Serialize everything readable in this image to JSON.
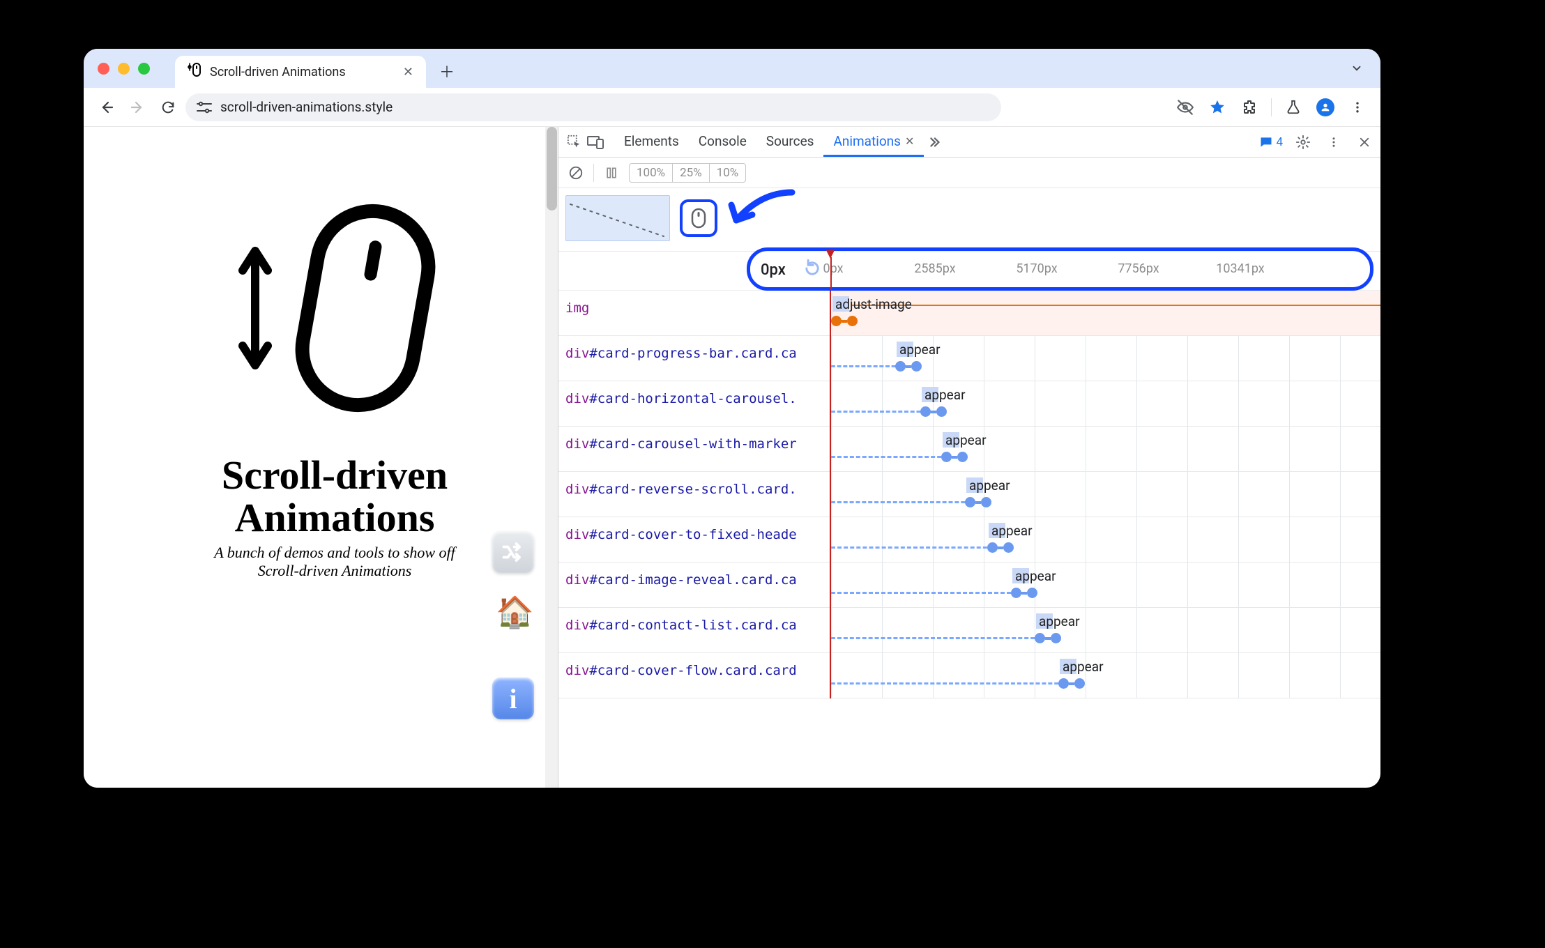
{
  "browser": {
    "tab_title": "Scroll-driven Animations",
    "url": "scroll-driven-animations.style",
    "messages_count": "4"
  },
  "page": {
    "title_line1": "Scroll-driven",
    "title_line2": "Animations",
    "subtitle_line1": "A bunch of demos and tools to show off",
    "subtitle_line2": "Scroll-driven Animations"
  },
  "devtools": {
    "tabs": [
      "Elements",
      "Console",
      "Sources",
      "Animations"
    ],
    "active_tab": "Animations",
    "speeds": [
      "100%",
      "25%",
      "10%"
    ],
    "timeline": {
      "current": "0px",
      "ticks": [
        "0px",
        "2585px",
        "5170px",
        "7756px",
        "10341px"
      ]
    },
    "rows": [
      {
        "tag": "img",
        "idclass": "",
        "anim": "adjust-image",
        "offset": 0
      },
      {
        "tag": "div",
        "idclass": "#card-progress-bar.card.ca",
        "anim": "appear",
        "offset": 92
      },
      {
        "tag": "div",
        "idclass": "#card-horizontal-carousel.",
        "anim": "appear",
        "offset": 128
      },
      {
        "tag": "div",
        "idclass": "#card-carousel-with-marker",
        "anim": "appear",
        "offset": 158
      },
      {
        "tag": "div",
        "idclass": "#card-reverse-scroll.card.",
        "anim": "appear",
        "offset": 192
      },
      {
        "tag": "div",
        "idclass": "#card-cover-to-fixed-heade",
        "anim": "appear",
        "offset": 224
      },
      {
        "tag": "div",
        "idclass": "#card-image-reveal.card.ca",
        "anim": "appear",
        "offset": 258
      },
      {
        "tag": "div",
        "idclass": "#card-contact-list.card.ca",
        "anim": "appear",
        "offset": 292
      },
      {
        "tag": "div",
        "idclass": "#card-cover-flow.card.card",
        "anim": "appear",
        "offset": 326
      }
    ]
  }
}
